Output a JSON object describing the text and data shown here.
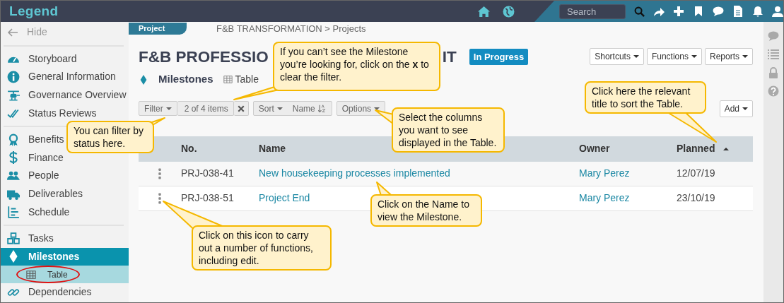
{
  "app": {
    "logo": "Legend"
  },
  "topbar": {
    "search": {
      "placeholder": "Search"
    }
  },
  "sidebar": {
    "hide": "Hide",
    "groups": [
      [
        {
          "label": "Storyboard",
          "selected": false
        },
        {
          "label": "General Information",
          "selected": false
        },
        {
          "label": "Governance Overview",
          "selected": false
        },
        {
          "label": "Status Reviews",
          "selected": false
        }
      ],
      [
        {
          "label": "Benefits",
          "selected": false
        },
        {
          "label": "Finance",
          "selected": false
        },
        {
          "label": "People",
          "selected": false
        },
        {
          "label": "Deliverables",
          "selected": false
        },
        {
          "label": "Schedule",
          "selected": false
        }
      ],
      [
        {
          "label": "Tasks",
          "selected": false
        },
        {
          "label": "Milestones",
          "selected": true,
          "children": [
            {
              "label": "Table",
              "selected": true
            }
          ]
        },
        {
          "label": "Dependencies",
          "selected": false
        }
      ]
    ]
  },
  "breadcrumb": {
    "tab": "Project",
    "path": "F&B TRANSFORMATION > Projects"
  },
  "title_parts": [
    "F&B PROFESSIO",
    "IT"
  ],
  "status": "In Progress",
  "header_buttons": [
    "Shortcuts",
    "Functions",
    "Reports"
  ],
  "section": {
    "title": "Milestones",
    "view": "Table"
  },
  "toolbar": {
    "filter": "Filter",
    "count": "2 of 4 items",
    "sort": "Sort",
    "sort_field": "Name",
    "options": "Options",
    "add": "Add"
  },
  "table": {
    "columns": [
      {
        "label": "No."
      },
      {
        "label": "Name"
      },
      {
        "label": "Owner"
      },
      {
        "label": "Planned",
        "sorted": true
      }
    ],
    "rows": [
      {
        "no": "PRJ-038-41",
        "name": "New housekeeping processes implemented",
        "owner": "Mary Perez",
        "planned": "12/07/19"
      },
      {
        "no": "PRJ-038-51",
        "name": "Project End",
        "owner": "Mary Perez",
        "planned": "23/10/19"
      }
    ]
  },
  "callouts": [
    {
      "text": "If you can’t see the Milestone you’re looking for, click on the **x** to clear the filter."
    },
    {
      "text": "You can filter by status here."
    },
    {
      "text": "Select the columns you want to see displayed in the Table."
    },
    {
      "text": "Click here the relevant title to sort the Table."
    },
    {
      "text": "Click on the Name to view the Milestone."
    },
    {
      "text": "Click on this icon to carry out a number of functions, including edit."
    }
  ]
}
